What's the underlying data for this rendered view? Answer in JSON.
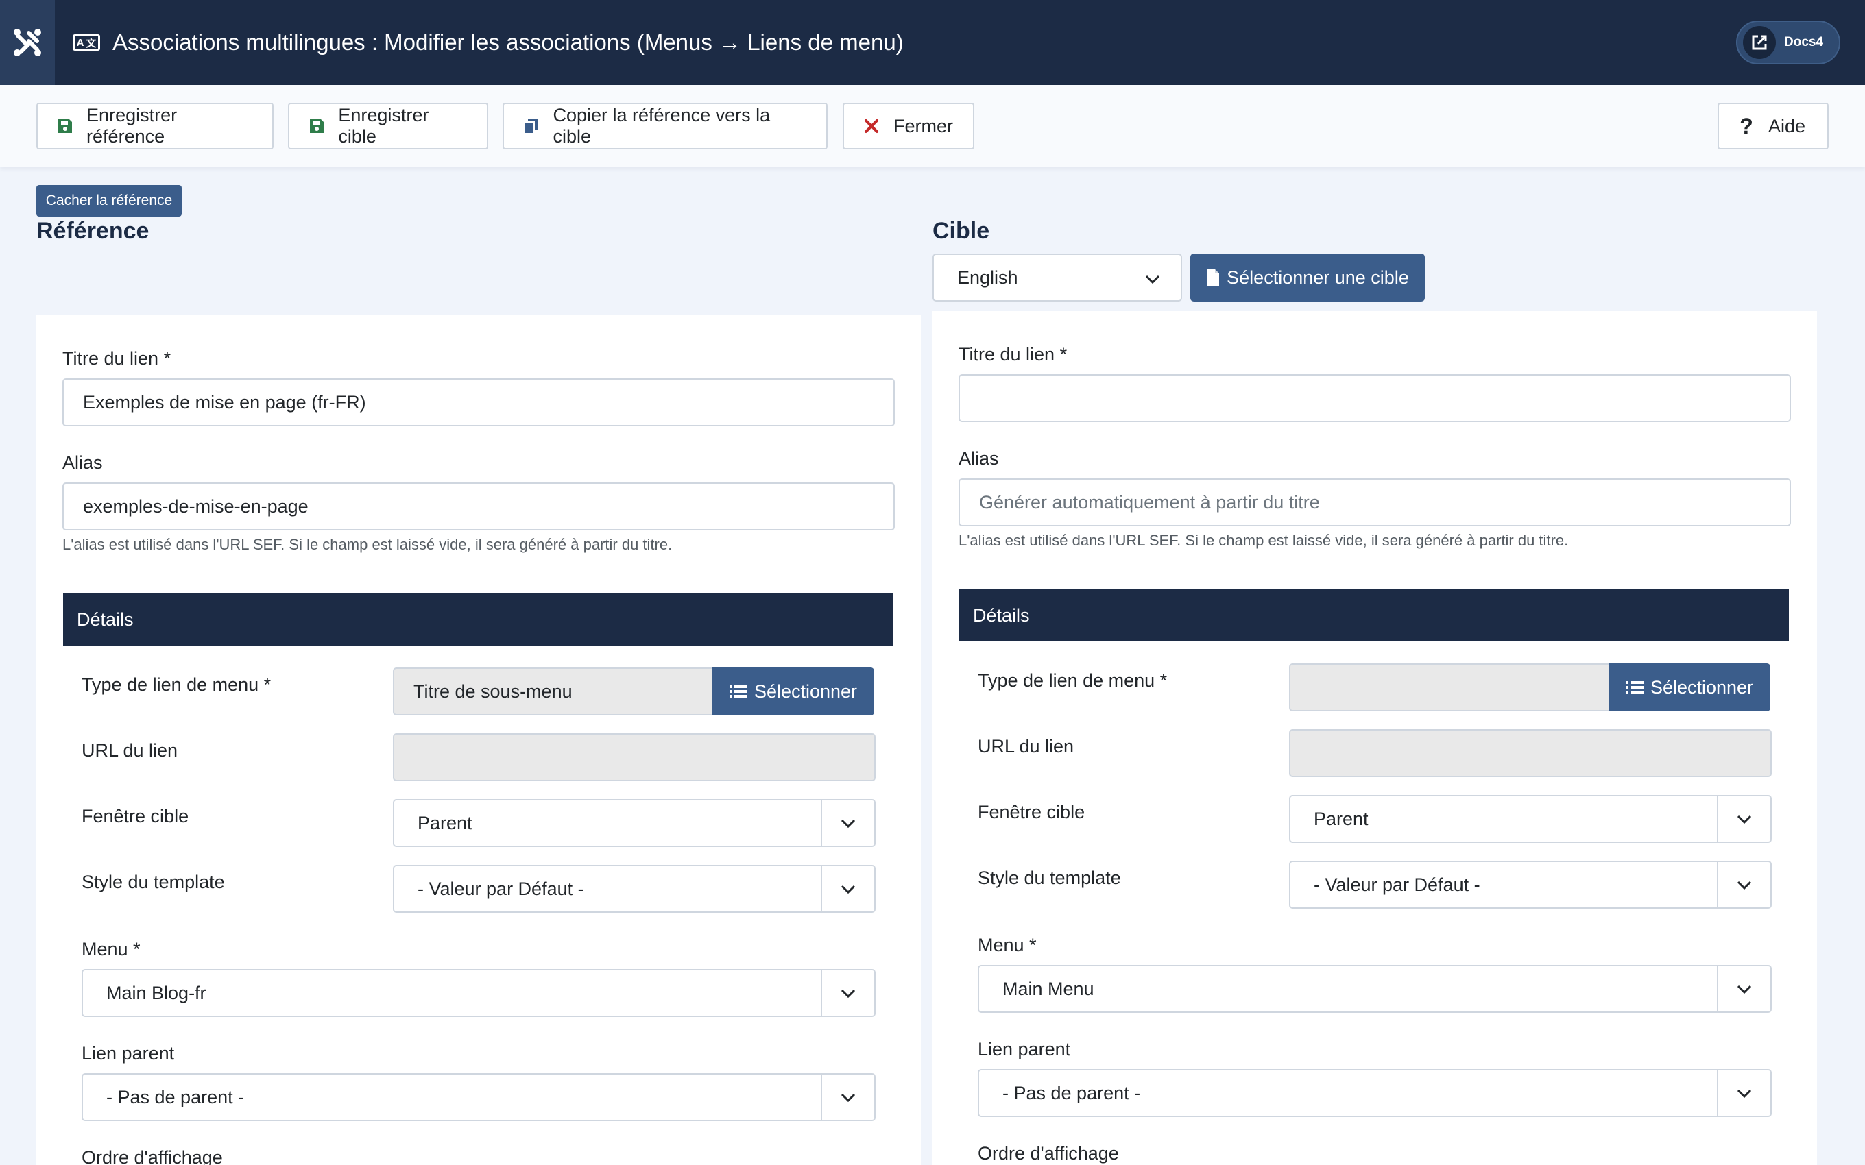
{
  "header": {
    "title": "Associations multilingues : Modifier les associations (Menus → Liens de menu)",
    "lang_icon_left": "A",
    "lang_icon_right": "文",
    "docs_label": "Docs4",
    "logo_icon": "joomla-logo-icon"
  },
  "toolbar": {
    "save_reference": "Enregistrer référence",
    "save_target": "Enregistrer cible",
    "copy_reference": "Copier la référence vers la cible",
    "close": "Fermer",
    "help": "Aide"
  },
  "colors": {
    "header_bg": "#1c2b45",
    "primary_button": "#3b5d8b",
    "save_icon": "#2f7d4a",
    "close_icon": "#c42a2a",
    "copy_icon": "#3b5d8b"
  },
  "hide_reference_label": "Cacher la référence",
  "reference": {
    "heading": "Référence",
    "link_title_label": "Titre du lien *",
    "link_title_value": "Exemples de mise en page (fr-FR)",
    "alias_label": "Alias",
    "alias_value": "exemples-de-mise-en-page",
    "alias_help": "L'alias est utilisé dans l'URL SEF. Si le champ est laissé vide, il sera généré à partir du titre.",
    "details_label": "Détails",
    "menu_item_type_label": "Type de lien de menu *",
    "menu_item_type_value": "Titre de sous-menu",
    "select_label": "Sélectionner",
    "link_url_label": "URL du lien",
    "link_url_value": "",
    "target_window_label": "Fenêtre cible",
    "target_window_value": "Parent",
    "template_style_label": "Style du template",
    "template_style_value": "- Valeur par Défaut -",
    "menu_label": "Menu *",
    "menu_value": "Main Blog-fr",
    "parent_label": "Lien parent",
    "parent_value": "- Pas de parent -",
    "ordering_label": "Ordre d'affichage"
  },
  "target": {
    "heading": "Cible",
    "language_value": "English",
    "select_target_label": "Sélectionner une cible",
    "link_title_label": "Titre du lien *",
    "link_title_value": "",
    "alias_label": "Alias",
    "alias_placeholder": "Générer automatiquement à partir du titre",
    "alias_help": "L'alias est utilisé dans l'URL SEF. Si le champ est laissé vide, il sera généré à partir du titre.",
    "details_label": "Détails",
    "menu_item_type_label": "Type de lien de menu *",
    "menu_item_type_value": "",
    "select_label": "Sélectionner",
    "link_url_label": "URL du lien",
    "link_url_value": "",
    "target_window_label": "Fenêtre cible",
    "target_window_value": "Parent",
    "template_style_label": "Style du template",
    "template_style_value": "- Valeur par Défaut -",
    "menu_label": "Menu *",
    "menu_value": "Main Menu",
    "parent_label": "Lien parent",
    "parent_value": "- Pas de parent -",
    "ordering_label": "Ordre d'affichage"
  }
}
